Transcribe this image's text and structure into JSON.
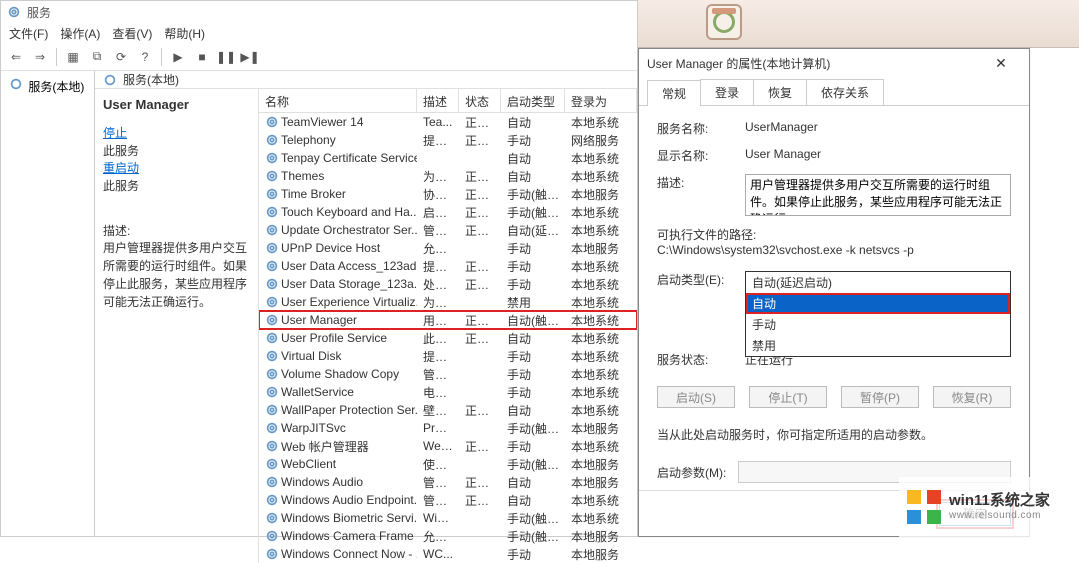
{
  "main": {
    "title": "服务",
    "menus": [
      "文件(F)",
      "操作(A)",
      "查看(V)",
      "帮助(H)"
    ],
    "nav_root": "服务(本地)",
    "detail_title": "服务(本地)",
    "selected_service": "User Manager",
    "stop_link_prefix": "停止",
    "stop_link_suffix": "此服务",
    "restart_link_prefix": "重启动",
    "restart_link_suffix": "此服务",
    "desc_heading": "描述:",
    "desc_text": "用户管理器提供多用户交互所需要的运行时组件。如果停止此服务，某些应用程序可能无法正确运行。",
    "columns": {
      "name": "名称",
      "desc": "描述",
      "status": "状态",
      "startup": "启动类型",
      "logon": "登录为"
    },
    "rows": [
      {
        "name": "TeamViewer 14",
        "desc": "Tea...",
        "status": "正在...",
        "startup": "自动",
        "logon": "本地系统"
      },
      {
        "name": "Telephony",
        "desc": "提供...",
        "status": "正在...",
        "startup": "手动",
        "logon": "网络服务"
      },
      {
        "name": "Tenpay Certificate Service",
        "desc": "",
        "status": "",
        "startup": "自动",
        "logon": "本地系统"
      },
      {
        "name": "Themes",
        "desc": "为用...",
        "status": "正在...",
        "startup": "自动",
        "logon": "本地系统"
      },
      {
        "name": "Time Broker",
        "desc": "协调...",
        "status": "正在...",
        "startup": "手动(触发...",
        "logon": "本地服务"
      },
      {
        "name": "Touch Keyboard and Ha...",
        "desc": "启用...",
        "status": "正在...",
        "startup": "手动(触发...",
        "logon": "本地系统"
      },
      {
        "name": "Update Orchestrator Ser...",
        "desc": "管理...",
        "status": "正在...",
        "startup": "自动(延迟...",
        "logon": "本地系统"
      },
      {
        "name": "UPnP Device Host",
        "desc": "允许...",
        "status": "",
        "startup": "手动",
        "logon": "本地服务"
      },
      {
        "name": "User Data Access_123ad...",
        "desc": "提供...",
        "status": "正在...",
        "startup": "手动",
        "logon": "本地系统"
      },
      {
        "name": "User Data Storage_123a...",
        "desc": "处理...",
        "status": "正在...",
        "startup": "手动",
        "logon": "本地系统"
      },
      {
        "name": "User Experience Virtualiz...",
        "desc": "为应...",
        "status": "",
        "startup": "禁用",
        "logon": "本地系统"
      },
      {
        "name": "User Manager",
        "desc": "用户...",
        "status": "正在...",
        "startup": "自动(触发...",
        "logon": "本地系统",
        "highlight": true
      },
      {
        "name": "User Profile Service",
        "desc": "此服...",
        "status": "正在...",
        "startup": "自动",
        "logon": "本地系统"
      },
      {
        "name": "Virtual Disk",
        "desc": "提供...",
        "status": "",
        "startup": "手动",
        "logon": "本地系统"
      },
      {
        "name": "Volume Shadow Copy",
        "desc": "管理...",
        "status": "",
        "startup": "手动",
        "logon": "本地系统"
      },
      {
        "name": "WalletService",
        "desc": "电子...",
        "status": "",
        "startup": "手动",
        "logon": "本地系统"
      },
      {
        "name": "WallPaper Protection Ser...",
        "desc": "壁纸...",
        "status": "正在...",
        "startup": "自动",
        "logon": "本地系统"
      },
      {
        "name": "WarpJITSvc",
        "desc": "Prov...",
        "status": "",
        "startup": "手动(触发...",
        "logon": "本地服务"
      },
      {
        "name": "Web 帐户管理器",
        "desc": "Web...",
        "status": "正在...",
        "startup": "手动",
        "logon": "本地系统"
      },
      {
        "name": "WebClient",
        "desc": "使基...",
        "status": "",
        "startup": "手动(触发...",
        "logon": "本地服务"
      },
      {
        "name": "Windows Audio",
        "desc": "管理...",
        "status": "正在...",
        "startup": "自动",
        "logon": "本地服务"
      },
      {
        "name": "Windows Audio Endpoint...",
        "desc": "管理...",
        "status": "正在...",
        "startup": "自动",
        "logon": "本地系统"
      },
      {
        "name": "Windows Biometric Servi...",
        "desc": "Win...",
        "status": "",
        "startup": "手动(触发...",
        "logon": "本地系统"
      },
      {
        "name": "Windows Camera Frame ...",
        "desc": "允许...",
        "status": "",
        "startup": "手动(触发...",
        "logon": "本地服务"
      },
      {
        "name": "Windows Connect Now - ...",
        "desc": "WC...",
        "status": "",
        "startup": "手动",
        "logon": "本地服务"
      }
    ]
  },
  "dialog": {
    "title": "User Manager 的属性(本地计算机)",
    "tabs": [
      "常规",
      "登录",
      "恢复",
      "依存关系"
    ],
    "svc_name_lbl": "服务名称:",
    "svc_name_val": "UserManager",
    "disp_name_lbl": "显示名称:",
    "disp_name_val": "User Manager",
    "desc_lbl": "描述:",
    "desc_val": "用户管理器提供多用户交互所需要的运行时组件。如果停止此服务，某些应用程序可能无法正确运行。",
    "exe_lbl": "可执行文件的路径:",
    "exe_val": "C:\\Windows\\system32\\svchost.exe -k netsvcs -p",
    "startup_lbl": "启动类型(E):",
    "startup_val": "自动",
    "startup_opts": [
      "自动(延迟启动)",
      "自动",
      "手动",
      "禁用"
    ],
    "status_lbl": "服务状态:",
    "status_val": "正在运行",
    "btns": [
      "启动(S)",
      "停止(T)",
      "暂停(P)",
      "恢复(R)"
    ],
    "note": "当从此处启动服务时，你可指定所适用的启动参数。",
    "param_lbl": "启动参数(M):",
    "ok": "确定"
  },
  "branding": {
    "site": "win11系统之家",
    "domain": "www.relsound.com"
  }
}
